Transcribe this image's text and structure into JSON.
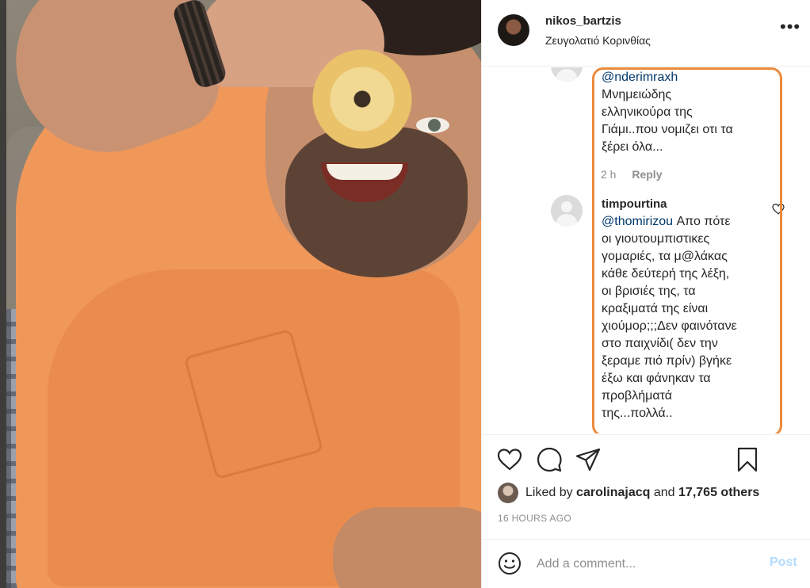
{
  "post": {
    "username": "nikos_bartzis",
    "location": "Ζευγολατιό Κορινθίας",
    "more_icon": "more-horizontal-icon"
  },
  "comments": [
    {
      "username": "",
      "mention": "@nderimraxh",
      "text_lines": [
        "Μνημειώδης",
        "ελληνικούρα της",
        "Γιάμι..που νομιζει οτι τα",
        "ξέρει όλα..."
      ],
      "time": "2 h",
      "reply_label": "Reply"
    },
    {
      "username": "timpourtina",
      "mention": "@thomirizou",
      "text_lines": [
        "Απο πότε",
        "οι γιουτουμπιστικες",
        "γομαριές, τα μ@λάκας",
        "κάθε δεύτερή της λέξη,",
        "οι βρισιές της, τα",
        "κραξιματά της είναι",
        "χιούμορ;;;Δεν φαινότανε",
        "στο παιχνίδι( δεν την",
        "ξεραμε πιό πρίν) βγήκε",
        "έξω και φάνηκαν τα",
        "προβλήματά",
        "της...πολλά.."
      ]
    }
  ],
  "actions": {
    "liked_prefix": "Liked by",
    "liked_user": "carolinajacq",
    "liked_and": "and",
    "liked_others": "17,765 others",
    "time_ago": "16 HOURS AGO"
  },
  "add_comment": {
    "placeholder": "Add a comment...",
    "post_label": "Post"
  },
  "colors": {
    "highlight": "#ec8a3c",
    "mention": "#00376b",
    "post_disabled": "#b3dbff"
  }
}
